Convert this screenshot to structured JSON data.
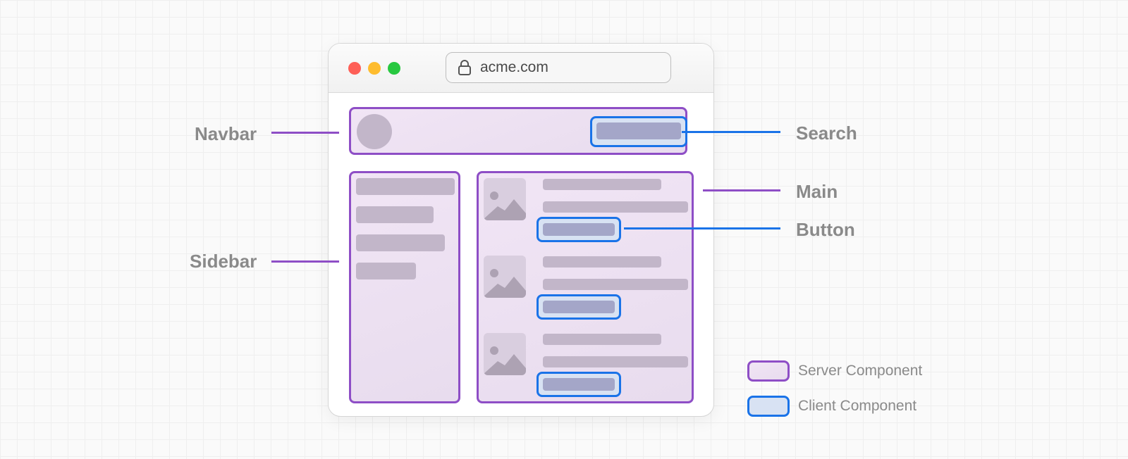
{
  "browser": {
    "url": "acme.com",
    "traffic_lights": [
      "#fe5f57",
      "#febc2e",
      "#28c840"
    ]
  },
  "labels": {
    "navbar": "Navbar",
    "sidebar": "Sidebar",
    "search": "Search",
    "main": "Main",
    "button": "Button"
  },
  "legend": {
    "server": "Server Component",
    "client": "Client Component"
  },
  "colors": {
    "server_border": "#8e4ec6",
    "client_border": "#1a73e8",
    "label_text": "#8a8a8a"
  },
  "icons": {
    "url": "lock-icon",
    "content_images": "image-placeholder-icon"
  }
}
